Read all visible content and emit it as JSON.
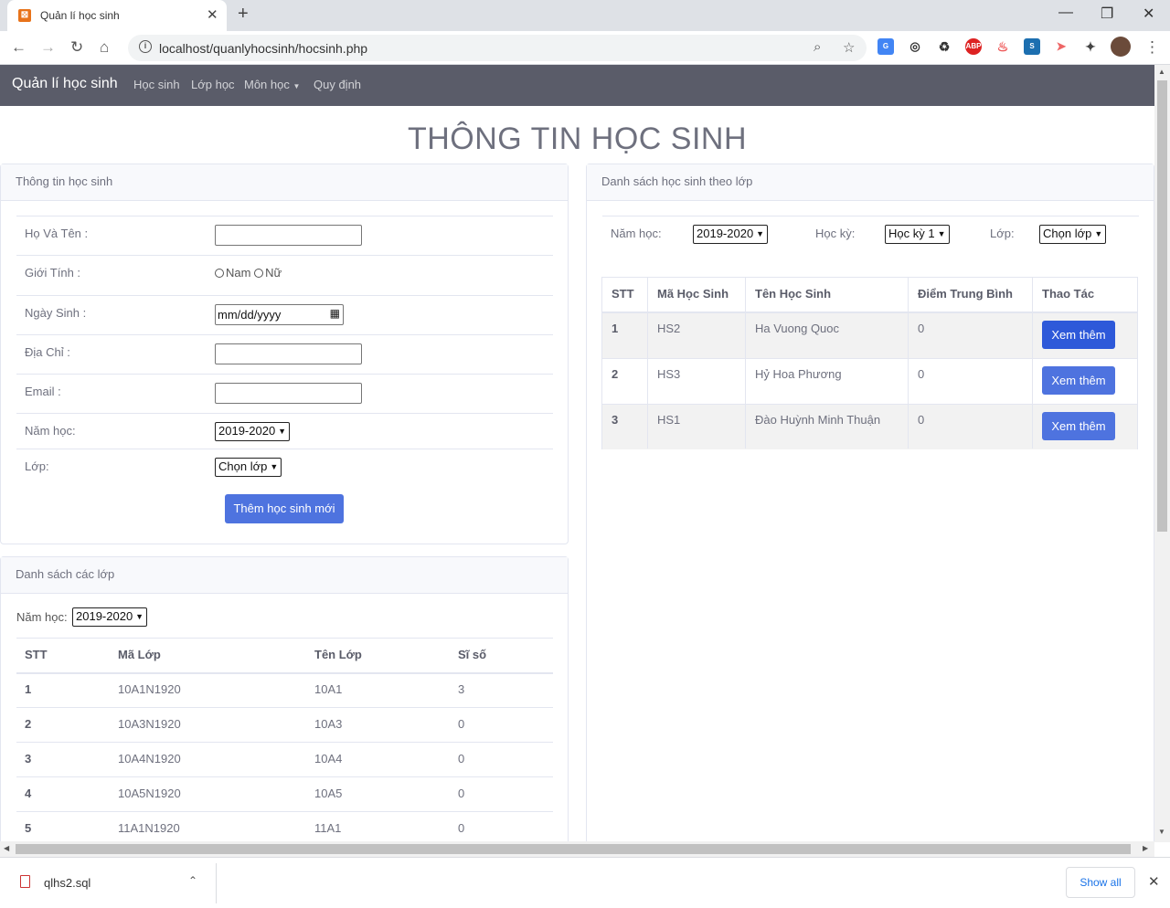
{
  "browser": {
    "tab_title": "Quản lí học sinh",
    "url": "localhost/quanlyhocsinh/hocsinh.php",
    "extensions": [
      "google-translate",
      "eye-slash",
      "recycle",
      "ABP",
      "fire",
      "scanner",
      "arrow",
      "puzzle",
      "avatar"
    ]
  },
  "navbar": {
    "brand": "Quản lí học sinh",
    "links": [
      "Học sinh",
      "Lớp học",
      "Môn học",
      "Quy định"
    ]
  },
  "page_title": "THÔNG TIN HỌC SINH",
  "student_form": {
    "header": "Thông tin học sinh",
    "name_label": "Họ Và Tên :",
    "gender_label": "Giới Tính :",
    "gender_male": "Nam",
    "gender_female": "Nữ",
    "dob_label": "Ngày Sinh :",
    "dob_placeholder": "mm/dd/yyyy",
    "address_label": "Địa Chỉ :",
    "email_label": "Email :",
    "year_label": "Năm học:",
    "year_value": "2019-2020",
    "class_label": "Lớp:",
    "class_value": "Chọn lớp",
    "submit": "Thêm học sinh mới"
  },
  "class_list": {
    "header": "Danh sách các lớp",
    "year_label": "Năm học:",
    "year_value": "2019-2020",
    "columns": [
      "STT",
      "Mã Lớp",
      "Tên Lớp",
      "Sĩ số"
    ],
    "rows": [
      [
        "1",
        "10A1N1920",
        "10A1",
        "3"
      ],
      [
        "2",
        "10A3N1920",
        "10A3",
        "0"
      ],
      [
        "3",
        "10A4N1920",
        "10A4",
        "0"
      ],
      [
        "4",
        "10A5N1920",
        "10A5",
        "0"
      ],
      [
        "5",
        "11A1N1920",
        "11A1",
        "0"
      ]
    ]
  },
  "student_list": {
    "header": "Danh sách học sinh theo lớp",
    "year_label": "Năm học:",
    "year_value": "2019-2020",
    "term_label": "Học kỳ:",
    "term_value": "Học kỳ 1",
    "class_label": "Lớp:",
    "class_value": "Chọn lớp",
    "columns": [
      "STT",
      "Mã Học Sinh",
      "Tên Học Sinh",
      "Điểm Trung Bình",
      "Thao Tác"
    ],
    "rows": [
      [
        "1",
        "HS2",
        "Ha Vuong Quoc",
        "0"
      ],
      [
        "2",
        "HS3",
        "Hỷ Hoa Phương",
        "0"
      ],
      [
        "3",
        "HS1",
        "Đào Huỳnh Minh Thuận",
        "0"
      ]
    ],
    "action_label": "Xem thêm"
  },
  "downloads": {
    "file": "qlhs2.sql",
    "show_all": "Show all"
  }
}
